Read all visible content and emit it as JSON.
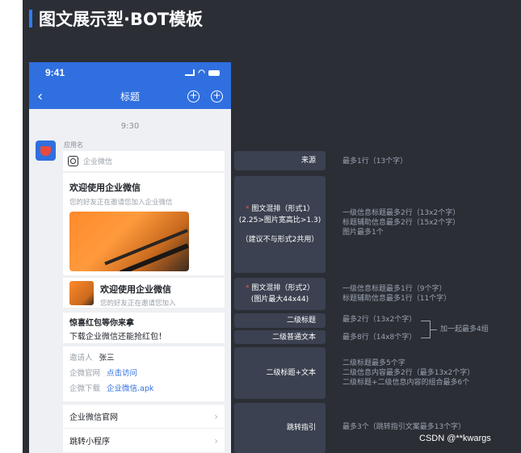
{
  "page_title": "图文展示型·BOT模板",
  "phone": {
    "status_time": "9:41",
    "nav_title": "标题",
    "chat_time": "9:30",
    "app_name": "应用名",
    "source_name": "企业微信",
    "article": {
      "title": "欢迎使用企业微信",
      "subtitle": "您的好友正在邀请您加入企业微信"
    },
    "article_small": {
      "title": "欢迎使用企业微信",
      "subtitle": "您的好友正在邀请您加入"
    },
    "secondary_title": "惊喜红包等你来拿",
    "secondary_text": "下载企业微信还能抢红包！",
    "kv": [
      {
        "key": "邀请人",
        "value": "张三",
        "link": false
      },
      {
        "key": "企微官网",
        "value": "点击访问",
        "link": true
      },
      {
        "key": "企微下载",
        "value": "企业微信.apk",
        "link": true
      }
    ],
    "jumps": [
      "企业微信官网",
      "跳转小程序"
    ]
  },
  "tags": {
    "source": "来源",
    "mix1_line1": "图文混排（形式1）",
    "mix1_line2": "(2.25>图片宽高比>1.3)",
    "mix1_line3": "（建议不与形式2共用）",
    "mix2_line1": "图文混排（形式2）",
    "mix2_line2": "(图片最大44x44)",
    "sec_title": "二级标题",
    "sec_text": "二级普通文本",
    "sec_title_text": "二级标题+文本",
    "jump": "跳转指引"
  },
  "notes": {
    "source": "最多1行（13个字）",
    "mix1": [
      "一级信息标题最多2行（13x2个字）",
      "标题辅助信息最多2行（15x2个字）",
      "图片最多1个"
    ],
    "mix2": [
      "一级信息标题最多1行（9个字）",
      "标题辅助信息最多1行（11个字）"
    ],
    "sec_title": "最多2行（13x2个字）",
    "sec_text": "最多8行（14x8个字）",
    "group": "加一起最多4组",
    "sec_title_text": [
      "二级标题最多5个字",
      "二级信息内容最多2行（最多13x2个字）",
      "二级标题+二级信息内容的组合最多6个"
    ],
    "jump": "最多3个（跳转指引文案最多13个字）"
  },
  "watermark": "CSDN @**kwargs",
  "colors": {
    "accent": "#2f6fe0",
    "background": "#2b2e35",
    "tag_bg": "#3b4150",
    "required": "#ff4d4f"
  }
}
